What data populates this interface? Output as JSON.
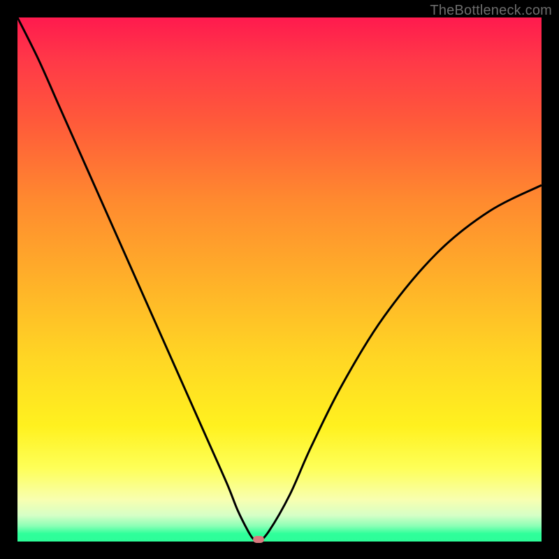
{
  "watermark": "TheBottleneck.com",
  "colors": {
    "page_bg": "#000000",
    "gradient_top": "#ff1a4e",
    "gradient_bottom": "#2dfd99",
    "curve": "#000000",
    "marker": "#d97a7f"
  },
  "chart_data": {
    "type": "line",
    "title": "",
    "xlabel": "",
    "ylabel": "",
    "xlim": [
      0,
      100
    ],
    "ylim": [
      0,
      100
    ],
    "legend": false,
    "grid": false,
    "background": "rainbow-gradient",
    "series": [
      {
        "name": "bottleneck-curve",
        "x": [
          0,
          4,
          8,
          12,
          16,
          20,
          24,
          28,
          32,
          36,
          40,
          42,
          44,
          45,
          46,
          48,
          52,
          56,
          62,
          70,
          80,
          90,
          100
        ],
        "y": [
          100,
          92,
          83,
          74,
          65,
          56,
          47,
          38,
          29,
          20,
          11,
          6,
          2,
          0.5,
          0,
          2,
          9,
          18,
          30,
          43,
          55,
          63,
          68
        ]
      }
    ],
    "min_marker": {
      "x": 46,
      "y": 0
    }
  }
}
